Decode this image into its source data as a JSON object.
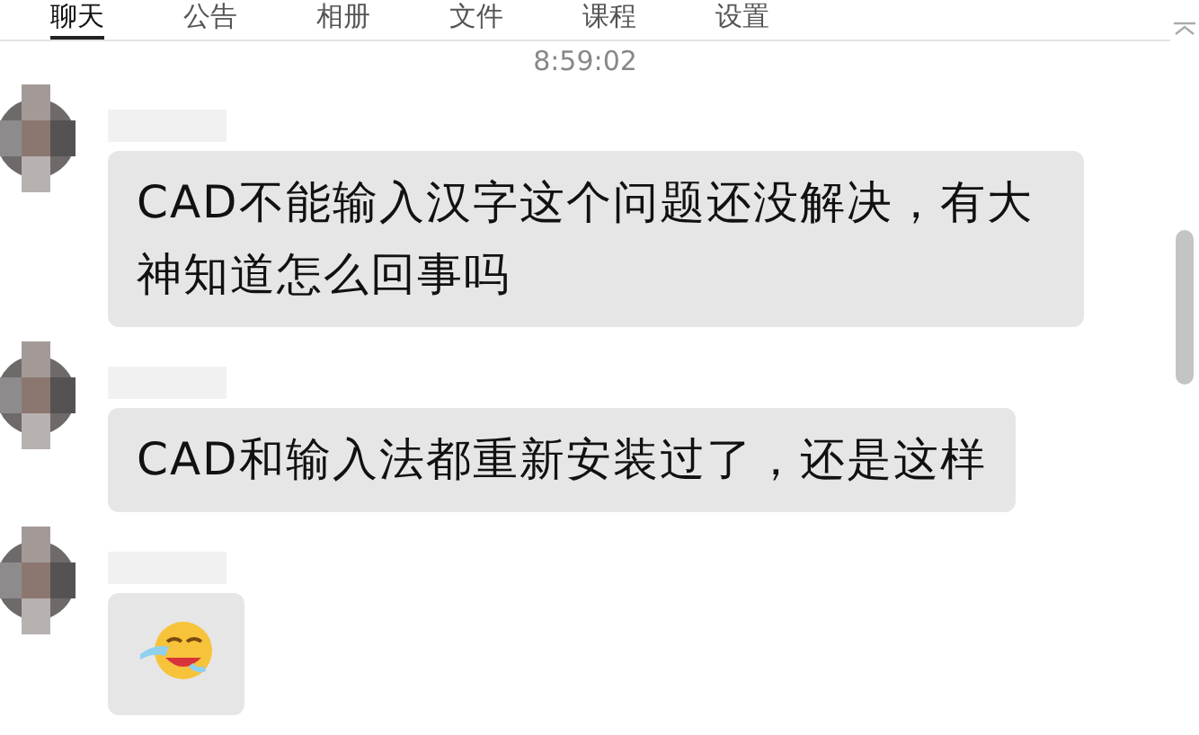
{
  "tabs": [
    {
      "label": "聊天",
      "selected": true
    },
    {
      "label": "公告",
      "selected": false
    },
    {
      "label": "相册",
      "selected": false
    },
    {
      "label": "文件",
      "selected": false
    },
    {
      "label": "课程",
      "selected": false
    },
    {
      "label": "设置",
      "selected": false
    }
  ],
  "timestamp": "8:59:02",
  "messages": [
    {
      "kind": "text",
      "text": "CAD不能输入汉字这个问题还没解决，有大神知道怎么回事吗"
    },
    {
      "kind": "text",
      "text": "CAD和输入法都重新安装过了，还是这样"
    },
    {
      "kind": "emoji"
    }
  ]
}
